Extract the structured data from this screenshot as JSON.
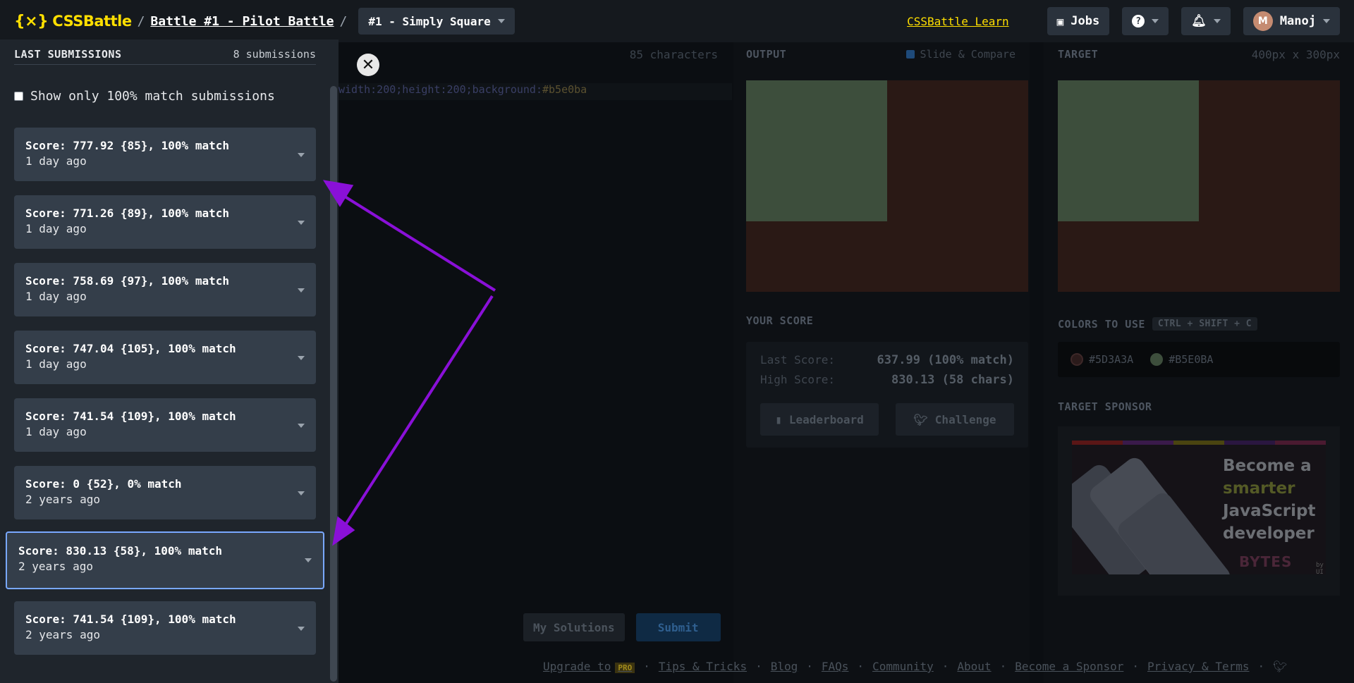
{
  "header": {
    "logo_text": "CSSBattle",
    "logo_mark": "{⨯}",
    "separator": "/",
    "battle": "Battle #1 - Pilot Battle",
    "level": "#1 - Simply Square",
    "learn": "CSSBattle Learn",
    "jobs": "Jobs",
    "help_icon": "?",
    "user": "Manoj",
    "avatar_letter": "M"
  },
  "sidebar": {
    "title": "LAST SUBMISSIONS",
    "count": "8 submissions",
    "filter_label": "Show only 100% match submissions",
    "submissions": [
      {
        "score": "Score: 777.92 {85}, 100% match",
        "time": "1 day ago"
      },
      {
        "score": "Score: 771.26 {89}, 100% match",
        "time": "1 day ago"
      },
      {
        "score": "Score: 758.69 {97}, 100% match",
        "time": "1 day ago"
      },
      {
        "score": "Score: 747.04 {105}, 100% match",
        "time": "1 day ago"
      },
      {
        "score": "Score: 741.54 {109}, 100% match",
        "time": "1 day ago"
      },
      {
        "score": "Score: 0 {52}, 0% match",
        "time": "2 years ago"
      },
      {
        "score": "Score: 830.13 {58}, 100% match",
        "time": "2 years ago"
      },
      {
        "score": "Score: 741.54 {109}, 100% match",
        "time": "2 years ago"
      }
    ]
  },
  "editor": {
    "chars": "85 characters",
    "code_prefix": "width:200;height:200;background:",
    "code_value": "#b5e0ba",
    "my_solutions": "My Solutions",
    "submit": "Submit"
  },
  "output": {
    "title": "OUTPUT",
    "slide_compare": "Slide & Compare",
    "your_score": "YOUR SCORE",
    "last_score_label": "Last Score:",
    "last_score_value": "637.99 (100% match)",
    "high_score_label": "High Score:",
    "high_score_value": "830.13 (58 chars)",
    "leaderboard": "Leaderboard",
    "challenge": "Challenge"
  },
  "target": {
    "title": "TARGET",
    "dims": "400px x 300px",
    "colors_title": "COLORS TO USE",
    "shortcut": "CTRL + SHIFT + C",
    "colors": [
      {
        "hex": "#5D3A3A",
        "swatch": "#5d3a3a"
      },
      {
        "hex": "#B5E0BA",
        "swatch": "#b5e0ba"
      }
    ],
    "sponsor_title": "TARGET SPONSOR",
    "sponsor_line1": "Become a",
    "sponsor_line2": "smarter",
    "sponsor_line3": "JavaScript",
    "sponsor_line4": "developer",
    "sponsor_logo": "BYTES",
    "sponsor_by": "by UI"
  },
  "footer": {
    "upgrade": "Upgrade to",
    "pro": "PRO",
    "tips": "Tips & Tricks",
    "blog": "Blog",
    "faqs": "FAQs",
    "community": "Community",
    "about": "About",
    "sponsor": "Become a Sponsor",
    "privacy": "Privacy & Terms",
    "separator": "·"
  },
  "colors": {
    "accent_yellow": "#ffdf00",
    "annotation_purple": "#8a10d8",
    "active_border": "#79a8ff"
  }
}
